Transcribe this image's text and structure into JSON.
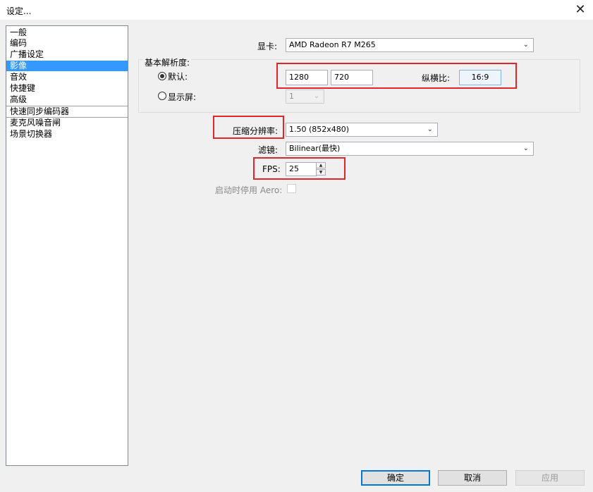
{
  "window": {
    "title": "设定...",
    "close_glyph": "✕"
  },
  "sidebar": {
    "items": [
      {
        "label": "一般"
      },
      {
        "label": "编码"
      },
      {
        "label": "广播设定"
      },
      {
        "label": "影像"
      },
      {
        "label": "音效"
      },
      {
        "label": "快捷键"
      },
      {
        "label": "高级"
      },
      {
        "label": "快速同步编码器"
      },
      {
        "label": "麦克风噪音闸"
      },
      {
        "label": "场景切换器"
      }
    ],
    "selected": "影像"
  },
  "video": {
    "gpu_label": "显卡:",
    "gpu_value": "AMD Radeon R7 M265",
    "base_res_label": "基本解析度:",
    "default_label": "默认:",
    "width": "1280",
    "height": "720",
    "aspect_label": "纵横比:",
    "aspect_value": "16:9",
    "monitor_label": "显示屏:",
    "monitor_value": "1",
    "downscale_label": "压缩分辨率:",
    "downscale_value": "1.50  (852x480)",
    "filter_label": "滤镜:",
    "filter_value": "Bilinear(最快)",
    "fps_label": "FPS:",
    "fps_value": "25",
    "aero_label": "启动时停用 Aero:"
  },
  "buttons": {
    "ok": "确定",
    "cancel": "取消",
    "apply": "应用"
  },
  "colors": {
    "selection": "#3399ff",
    "highlight_box": "#e0262a",
    "default_button_border": "#0078d7"
  },
  "icons": {
    "close": "close-icon",
    "dropdown": "chevron-down-icon",
    "spin_up": "spin-up-icon",
    "spin_down": "spin-down-icon"
  }
}
